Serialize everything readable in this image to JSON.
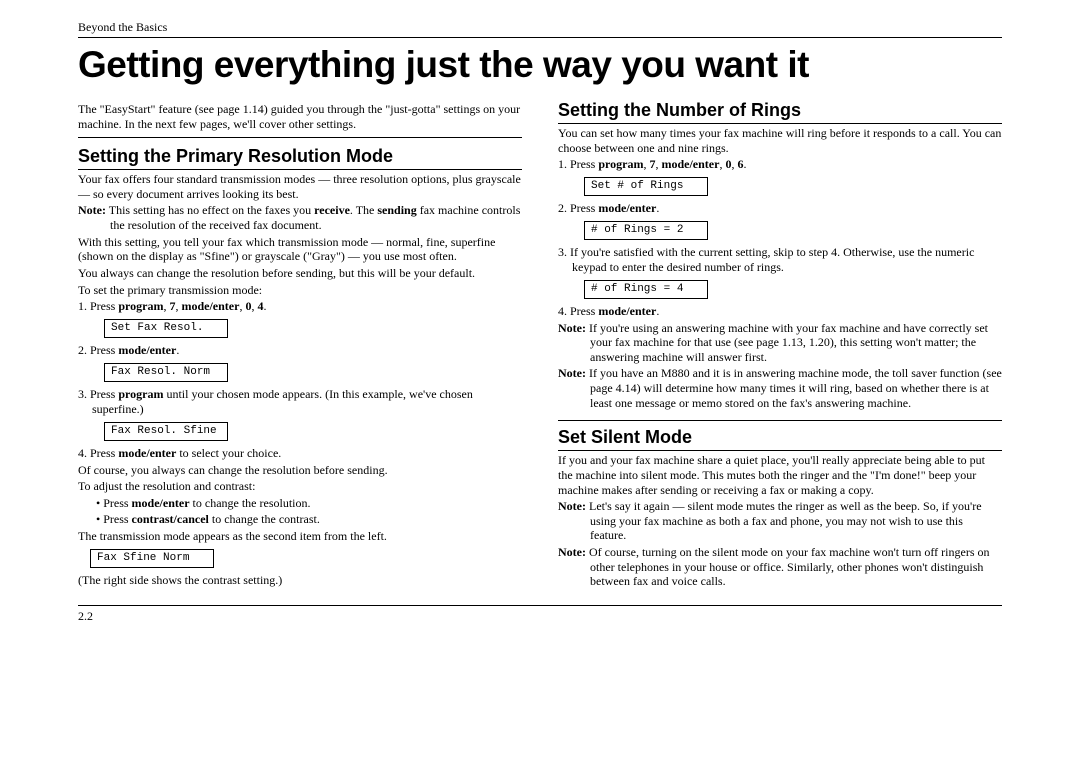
{
  "header": "Beyond the Basics",
  "title": "Getting everything just the way you want it",
  "intro": "The \"EasyStart\" feature (see page 1.14) guided you through the \"just-gotta\" settings on your machine. In the next few pages, we'll cover other settings.",
  "left": {
    "h": "Setting the Primary Resolution Mode",
    "p1": "Your fax offers four standard transmission modes — three resolution options, plus grayscale — so every document arrives looking its best.",
    "note1_label": "Note:",
    "note1a": " This setting has no effect on the faxes you ",
    "note1b": "receive",
    "note1c": ". The ",
    "note1d": "sending",
    "note1e": " fax machine controls the resolution of the received fax document.",
    "p2": "With this setting, you tell your fax which transmission mode — normal, fine, superfine (shown on the display as \"Sfine\") or grayscale (\"Gray\") — you use most often.",
    "p3": "You always can change the resolution before sending, but this will be your default.",
    "p4": "To set the primary transmission mode:",
    "s1a": "1. Press ",
    "s1b": "program",
    "s1c": ", ",
    "s1d": "7",
    "s1e": ", ",
    "s1f": "mode/enter",
    "s1g": ", ",
    "s1h": "0",
    "s1i": ", ",
    "s1j": "4",
    "s1k": ".",
    "d1": "Set Fax Resol.",
    "s2a": "2. Press ",
    "s2b": "mode/enter",
    "s2c": ".",
    "d2": "Fax Resol. Norm",
    "s3a": "3. Press ",
    "s3b": "program",
    "s3c": " until your chosen mode appears. (In this example, we've chosen superfine.)",
    "d3": "Fax Resol. Sfine",
    "s4a": "4. Press ",
    "s4b": "mode/enter",
    "s4c": " to select your choice.",
    "p5": "Of course, you always can change the resolution before sending.",
    "p6": "To adjust the resolution and contrast:",
    "b1a": "• Press ",
    "b1b": "mode/enter",
    "b1c": " to change the resolution.",
    "b2a": "• Press ",
    "b2b": "contrast/cancel",
    "b2c": " to change the contrast.",
    "p7": "The transmission mode appears as the second item from the left.",
    "d4": "Fax  Sfine Norm",
    "p8": "(The right side shows the contrast setting.)"
  },
  "right": {
    "h1": "Setting the Number of Rings",
    "r1": "You can set how many times your fax machine will ring before it responds to a call. You can choose between one and nine rings.",
    "rs1a": "1. Press ",
    "rs1b": "program",
    "rs1c": ", ",
    "rs1d": "7",
    "rs1e": ", ",
    "rs1f": "mode/enter",
    "rs1g": ", ",
    "rs1h": "0",
    "rs1i": ", ",
    "rs1j": "6",
    "rs1k": ".",
    "rd1": "Set # of Rings",
    "rs2a": "2. Press ",
    "rs2b": "mode/enter",
    "rs2c": ".",
    "rd2": "# of Rings = 2",
    "rs3": "3. If you're satisfied with the current setting, skip to step 4. Otherwise, use the numeric keypad to enter the desired number of rings.",
    "rd3": "# of Rings = 4",
    "rs4a": "4. Press ",
    "rs4b": "mode/enter",
    "rs4c": ".",
    "rn1_label": "Note:",
    "rn1": " If you're using an answering machine with your fax machine and have correctly set your fax machine for that use (see page 1.13, 1.20), this setting won't matter; the answering machine will answer first.",
    "rn2_label": "Note:",
    "rn2": " If you have an M880 and it is in answering machine mode, the toll saver function (see page 4.14) will determine how many times it will ring, based on whether there is at least one message or memo stored on the fax's answering machine.",
    "h2": "Set Silent Mode",
    "s1": "If you and your fax machine share a quiet place, you'll really appreciate being able to put the machine into silent mode. This mutes both the ringer and the \"I'm done!\" beep your machine makes after sending or receiving a fax or making a copy.",
    "sn1_label": "Note:",
    "sn1": " Let's say it again — silent mode mutes the ringer as well as the beep. So, if you're using your fax machine as both a fax and phone, you may not wish to use this feature.",
    "sn2_label": "Note:",
    "sn2": " Of course, turning on the silent mode on your fax machine won't turn off ringers on other telephones in your house or office. Similarly, other phones won't distinguish between fax and voice calls."
  },
  "footer": "2.2"
}
